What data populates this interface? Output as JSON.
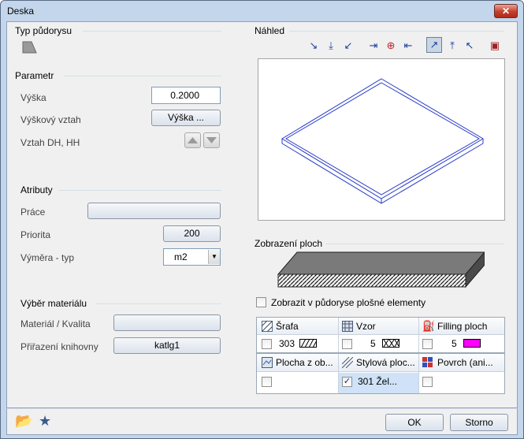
{
  "window": {
    "title": "Deska",
    "close_label": "✕"
  },
  "typ": {
    "heading": "Typ půdorysu"
  },
  "parametr": {
    "heading": "Parametr",
    "vyska_label": "Výška",
    "vyska_value": "0.2000",
    "vztah_label": "Výškový vztah",
    "vztah_button": "Výška ...",
    "dh_label": "Vztah DH, HH"
  },
  "atributy": {
    "heading": "Atributy",
    "prace_label": "Práce",
    "prace_value": "",
    "priorita_label": "Priorita",
    "priorita_value": "200",
    "vymera_label": "Výměra - typ",
    "vymera_value": "m2"
  },
  "material": {
    "heading": "Výběr materiálu",
    "kvalita_label": "Materiál / Kvalita",
    "kvalita_value": "",
    "knihovna_label": "Přiřazení knihovny",
    "knihovna_value": "katlg1"
  },
  "preview": {
    "heading": "Náhled"
  },
  "zobrazeni": {
    "heading": "Zobrazení ploch",
    "checkbox_label": "Zobrazit v půdoryse plošné elementy",
    "row1": [
      {
        "label": "Šrafa",
        "value": "303",
        "swatch": "#ffffff"
      },
      {
        "label": "Vzor",
        "value": "5",
        "swatch": "#ffffff"
      },
      {
        "label": "Filling ploch",
        "value": "5",
        "swatch": "#ff00ff"
      }
    ],
    "row2": [
      {
        "label": "Plocha z ob...",
        "value": ""
      },
      {
        "label": "Stylová ploc...",
        "value": "301 Žel..."
      },
      {
        "label": "Povrch (ani...",
        "value": ""
      }
    ]
  },
  "footer": {
    "ok": "OK",
    "storno": "Storno"
  },
  "colors": {
    "accent": "#2a3cc8",
    "fill_magenta": "#ff00ff"
  }
}
